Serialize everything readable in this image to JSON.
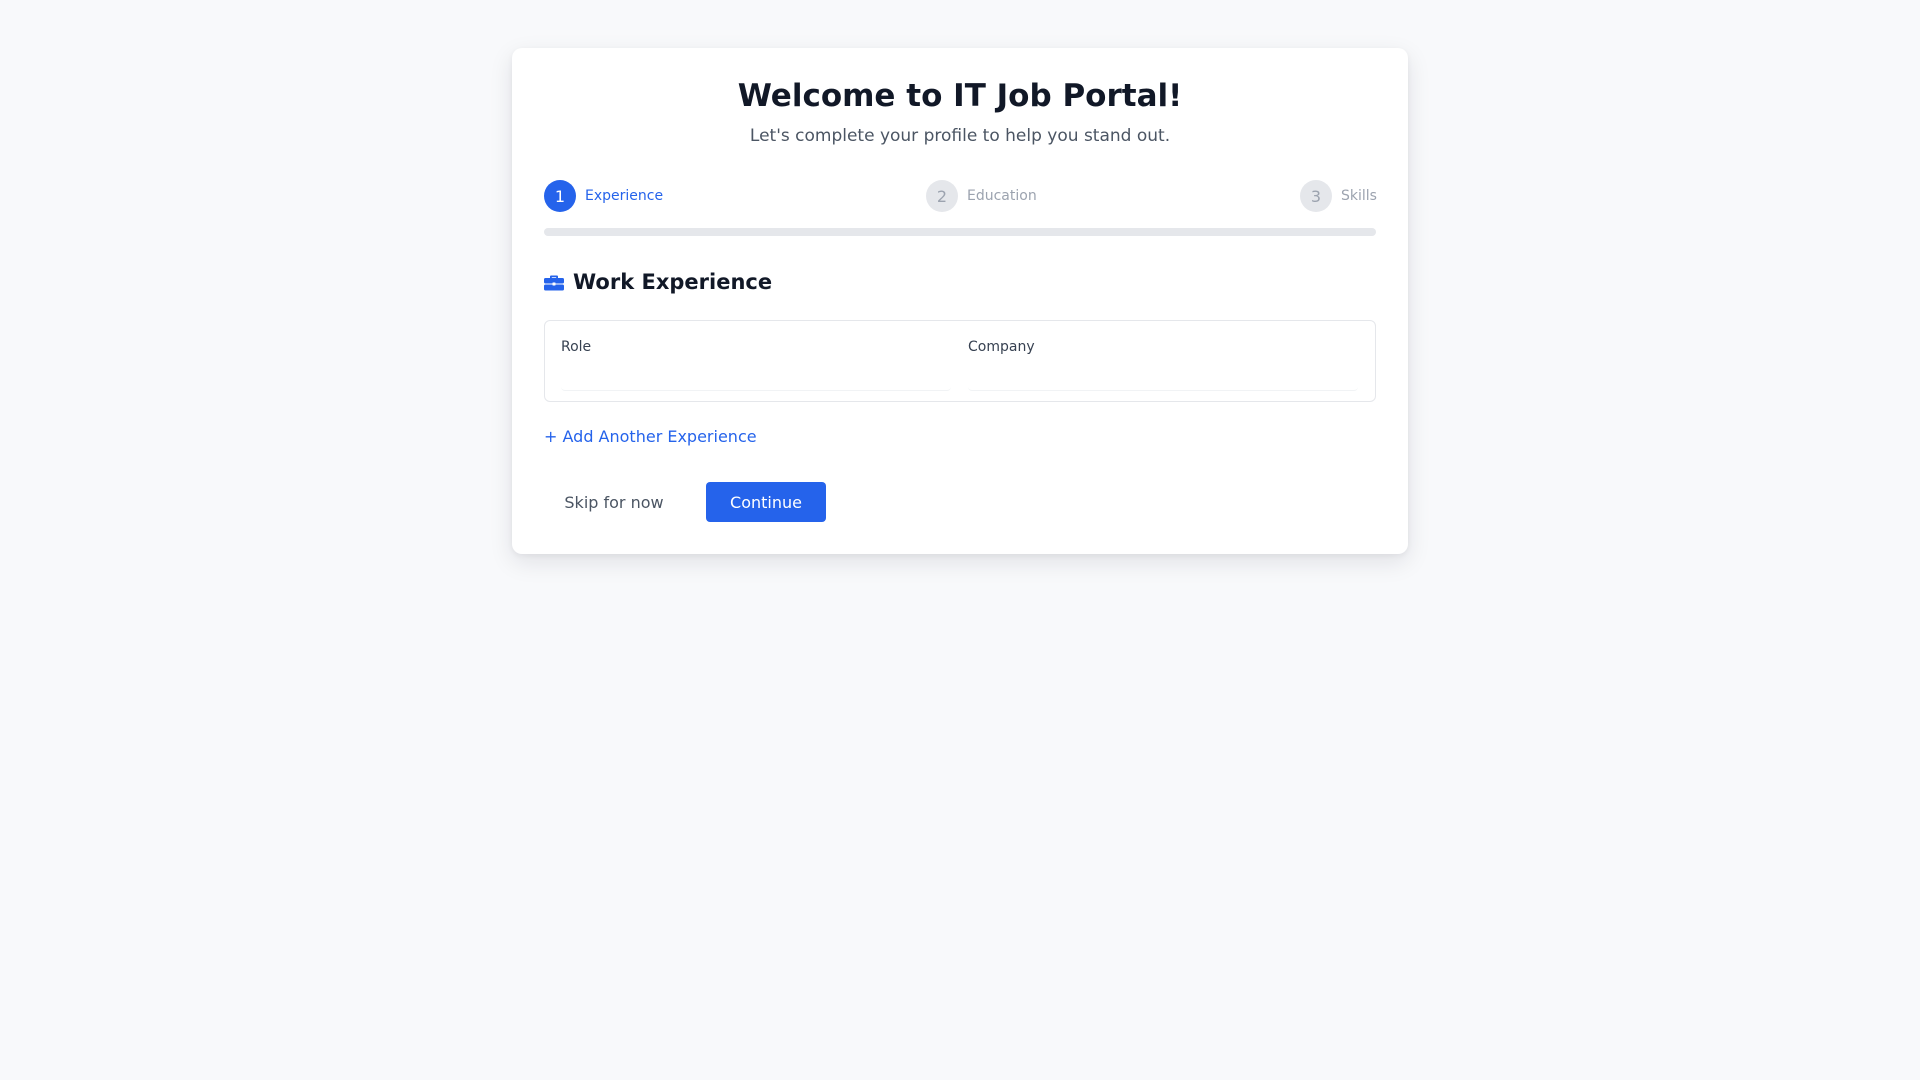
{
  "header": {
    "title": "Welcome to IT Job Portal!",
    "subtitle": "Let's complete your profile to help you stand out."
  },
  "stepper": {
    "steps": [
      {
        "number": "1",
        "label": "Experience",
        "state": "active"
      },
      {
        "number": "2",
        "label": "Education",
        "state": "inactive"
      },
      {
        "number": "3",
        "label": "Skills",
        "state": "inactive"
      }
    ],
    "progress_percent": 0
  },
  "section": {
    "icon": "briefcase-icon",
    "title": "Work Experience"
  },
  "experience_form": {
    "role_label": "Role",
    "role_value": "",
    "company_label": "Company",
    "company_value": ""
  },
  "actions": {
    "add_another_label": "+ Add Another Experience",
    "skip_label": "Skip for now",
    "continue_label": "Continue"
  },
  "colors": {
    "accent": "#2563eb",
    "inactive_step": "#e5e7eb",
    "background": "#f8f9fb"
  }
}
